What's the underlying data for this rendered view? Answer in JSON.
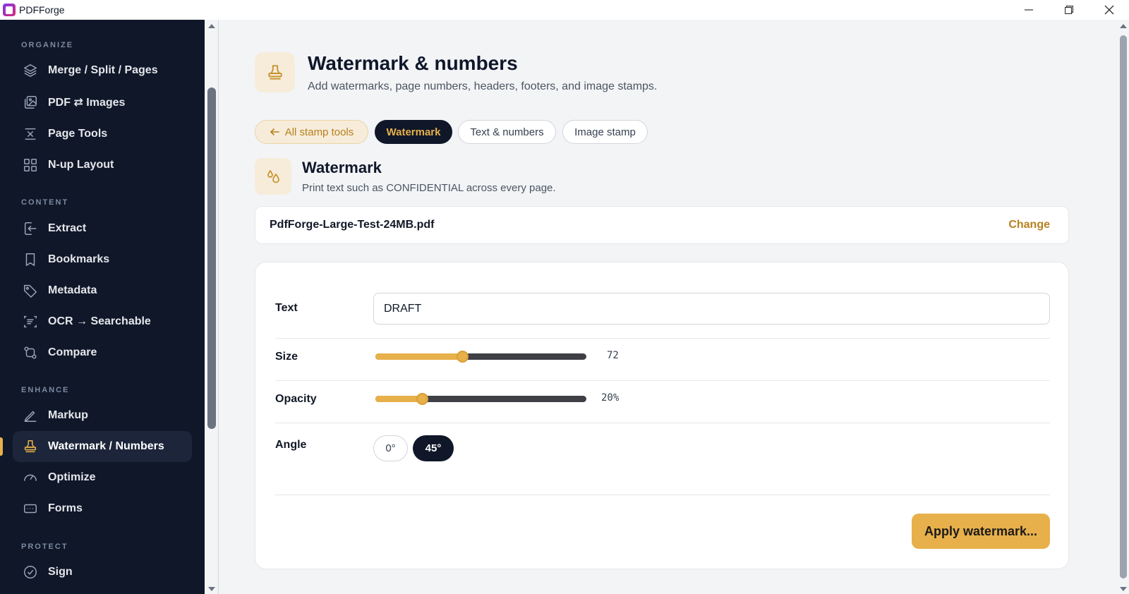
{
  "window": {
    "title": "PDFForge"
  },
  "sidebar": {
    "sections": {
      "organize": "ORGANIZE",
      "content": "CONTENT",
      "enhance": "ENHANCE",
      "protect": "PROTECT"
    },
    "items": [
      {
        "label": "Merge / Split / Pages",
        "icon": "layers-icon"
      },
      {
        "label": "PDF ⇄ Images",
        "icon": "images-icon"
      },
      {
        "label": "Page Tools",
        "icon": "page-tools-icon"
      },
      {
        "label": "N-up Layout",
        "icon": "grid-icon"
      },
      {
        "label": "Extract",
        "icon": "extract-icon"
      },
      {
        "label": "Bookmarks",
        "icon": "bookmark-icon"
      },
      {
        "label": "Metadata",
        "icon": "tag-icon"
      },
      {
        "label": "OCR → Searchable",
        "icon": "scan-icon"
      },
      {
        "label": "Compare",
        "icon": "compare-icon"
      },
      {
        "label": "Markup",
        "icon": "pen-icon"
      },
      {
        "label": "Watermark / Numbers",
        "icon": "stamp-icon",
        "active": true
      },
      {
        "label": "Optimize",
        "icon": "gauge-icon"
      },
      {
        "label": "Forms",
        "icon": "form-icon"
      },
      {
        "label": "Sign",
        "icon": "check-circle-icon"
      }
    ]
  },
  "header": {
    "title": "Watermark & numbers",
    "subtitle": "Add watermarks, page numbers, headers, footers, and image stamps."
  },
  "tabs": {
    "back": "All stamp tools",
    "watermark": "Watermark",
    "text_numbers": "Text & numbers",
    "image_stamp": "Image stamp"
  },
  "tool": {
    "title": "Watermark",
    "description": "Print text such as CONFIDENTIAL across every page."
  },
  "file": {
    "name": "PdfForge-Large-Test-24MB.pdf",
    "change_label": "Change"
  },
  "options": {
    "text_label": "Text",
    "text_value": "DRAFT",
    "size_label": "Size",
    "size_value": "72",
    "size_fraction": 0.41,
    "opacity_label": "Opacity",
    "opacity_value": "20%",
    "opacity_fraction": 0.22,
    "angle_label": "Angle",
    "angle_options": [
      "0°",
      "45°"
    ],
    "angle_selected": "45°"
  },
  "actions": {
    "apply_label": "Apply watermark..."
  },
  "colors": {
    "accent": "#e8b04a",
    "sidebar_bg": "#0f1729",
    "accent_text": "#b7801f"
  }
}
